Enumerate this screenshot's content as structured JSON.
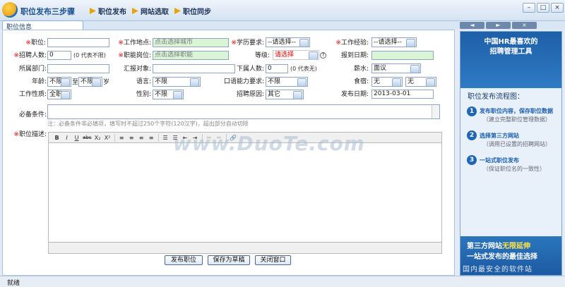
{
  "app": {
    "title": "职位发布三步骤"
  },
  "steps": [
    "职位发布",
    "网站选取",
    "职位同步"
  ],
  "tab": "职位信息",
  "nav": {
    "prev": "◄",
    "next": "►"
  },
  "window_buttons": [
    "–",
    "□",
    "×"
  ],
  "form": {
    "position_label": "职位:",
    "location_label": "工作地点:",
    "location_value": "点击选择城市",
    "education_label": "学历要求:",
    "education_value": "--请选择--",
    "experience_label": "工作经验:",
    "experience_value": "--请选择--",
    "headcount_label": "招聘人数:",
    "headcount_value": "0",
    "headcount_hint": "(0 代表不限)",
    "job_function_label": "职能岗位:",
    "job_function_value": "点击选择职能",
    "level_label": "等级:",
    "level_value": "请选择",
    "help_mark": "?",
    "report_date_label": "报到日期:",
    "department_label": "所属部门:",
    "report_to_label": "汇报对象:",
    "subordinates_label": "下属人数:",
    "subordinates_value": "0",
    "subordinates_hint": "(0 代表无)",
    "salary_label": "薪水:",
    "salary_value": "面议",
    "age_label": "年龄:",
    "age_from": "不限",
    "age_to_text": "至",
    "age_to": "不限",
    "age_unit": "岁",
    "language_label": "语言:",
    "language_value": "不限",
    "oral_label": "口语能力要求:",
    "oral_value": "不限",
    "board_label": "食宿:",
    "board_value1": "无",
    "board_value2": "无",
    "nature_label": "工作性质:",
    "nature_value": "全职",
    "gender_label": "性别:",
    "gender_value": "不限",
    "reason_label": "招聘原因:",
    "reason_value": "其它",
    "publish_date_label": "发布日期:",
    "publish_date_value": "2013-03-01",
    "requirements_label": "必备条件:",
    "requirements_note": "注：必备条件非必填项，填写时不超过250个字符(120汉字)，超出部分自动切除",
    "description_label": "职位描述:"
  },
  "editor_tools": [
    "B",
    "I",
    "U",
    "abc",
    "X₂",
    "X²",
    "≡",
    "≡",
    "≡",
    "≡",
    "☰",
    "☰",
    "⇤",
    "⇥",
    "✂",
    "✂",
    "🔗"
  ],
  "buttons": {
    "publish": "发布职位",
    "draft": "保存为草稿",
    "close": "关闭窗口"
  },
  "sidebar": {
    "title_line1": "中国HR最喜欢的",
    "title_line2": "招聘管理工具",
    "flow_title": "职位发布流程图：",
    "items": [
      {
        "num": "1",
        "title": "发布职位内容，保存职位数据",
        "desc": "（建立完整职位管理数据）"
      },
      {
        "num": "2",
        "title": "选择第三方网站",
        "desc": "（调用已设置的招聘网站）"
      },
      {
        "num": "3",
        "title": "一站式职位发布",
        "desc": "（保证职位名的一致性）"
      }
    ],
    "ad_line1a": "第三方网站",
    "ad_line1b": "无限延伸",
    "ad_line2": "一站式发布的最佳选择",
    "watermark": "国内最安全的软件站"
  },
  "watermark": "www.DuoTe.com",
  "status": "就绪"
}
